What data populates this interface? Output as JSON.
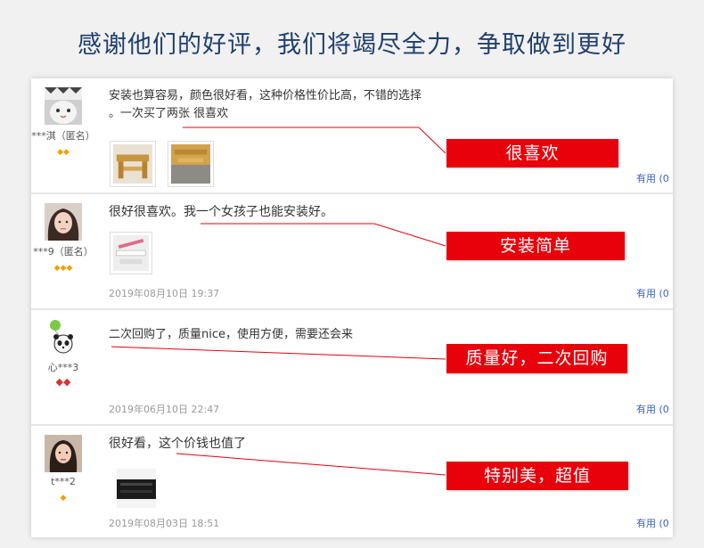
{
  "headline": "感谢他们的好评，我们将竭尽全力，争取做到更好",
  "useful_label": "有用 (0",
  "reviews": [
    {
      "username": "***淇（匿名）",
      "badges": "◆◆",
      "text_line1": "安装也算容易，颜色很好看，这种价格性价比高，不错的选择",
      "text_line2": "。一次买了两张 很喜欢",
      "date": "",
      "callout": "很喜欢"
    },
    {
      "username": "***9（匿名）",
      "badges": "◆◆◆",
      "text_line1": "很好很喜欢。我一个女孩子也能安装好。",
      "date": "2019年08月10日 19:37",
      "callout": "安装简单"
    },
    {
      "username": "心***3",
      "badges": "◆◆",
      "text_line1": "二次回购了，质量nice，使用方便，需要还会来",
      "date": "2019年06月10日 22:47",
      "callout": "质量好，二次回购"
    },
    {
      "username": "t***2",
      "badges": "◆",
      "text_line1": "很好看，这个价钱也值了",
      "date": "2019年08月03日 18:51",
      "callout": "特别美，超值"
    }
  ]
}
